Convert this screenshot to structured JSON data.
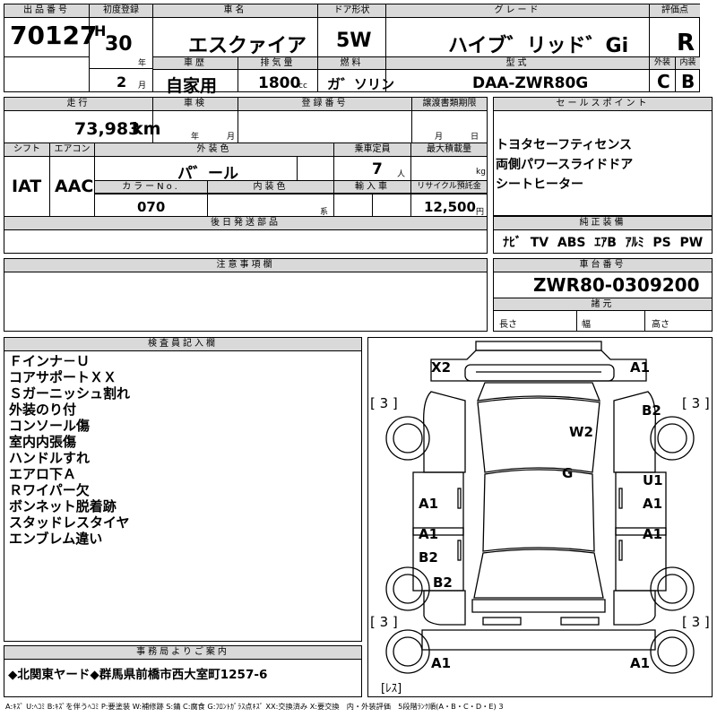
{
  "header": {
    "lot_label": "出品番号",
    "lot_no": "70127",
    "first_reg_label": "初度登録",
    "era": "H",
    "year": "30",
    "year_unit": "年",
    "month": "2",
    "month_unit": "月",
    "car_name_label": "車名",
    "car_name": "エスクァイア",
    "door_label": "ドア形状",
    "door": "5W",
    "grade_label": "グレード",
    "grade": "ハイブ゛リッド゛Gi",
    "score_label": "評価点",
    "score": "R",
    "history_label": "車歴",
    "history": "自家用",
    "disp_label": "排気量",
    "disp": "1800",
    "disp_unit": "cc",
    "fuel_label": "燃料",
    "fuel": "ガ゛ソリン",
    "model_label": "型式",
    "model": "DAA-ZWR80G",
    "ext_label": "外装",
    "ext": "C",
    "int_label": "内装",
    "int": "B"
  },
  "row2": {
    "mileage_label": "走行",
    "mileage": "73,983",
    "mileage_unit": "km",
    "inspection_label": "車検",
    "insp_year_unit": "年",
    "insp_month_unit": "月",
    "regno_label": "登録番号",
    "transfer_label": "譲渡書類期限",
    "trans_month_unit": "月",
    "trans_day_unit": "日",
    "shift_label": "シフト",
    "shift": "IAT",
    "ac_label": "エアコン",
    "ac": "AAC",
    "color_label": "外装色",
    "color": "パ゛ール",
    "seats_label": "乗車定員",
    "seats": "7",
    "seats_unit": "人",
    "load_label": "最大積載量",
    "load_unit": "kg",
    "colorno_label": "カラーNo.",
    "colorno": "070",
    "intcolor_label": "内装色",
    "intcolor_unit": "系",
    "import_label": "輸入車",
    "recycle_label": "リサイクル預託金",
    "recycle": "12,500",
    "recycle_unit": "円",
    "later_label": "後日発送部品"
  },
  "sales": {
    "label": "セールスポイント",
    "items": [
      "トヨタセーフティセンス",
      "両側パワースライドドア",
      "シートヒーター"
    ]
  },
  "equipment": {
    "label": "純正装備",
    "items": [
      "ﾅﾋﾞ",
      "TV",
      "ABS",
      "ｴｱB",
      "ｱﾙﾐ",
      "PS",
      "PW"
    ]
  },
  "notes": {
    "label": "注意事項欄"
  },
  "chassis": {
    "label": "車台番号",
    "value": "ZWR80-0309200",
    "dims_label": "諸元",
    "length_label": "長さ",
    "width_label": "幅",
    "height_label": "高さ"
  },
  "inspector": {
    "label": "検査員記入欄",
    "items": [
      "Ｆインナ－Ｕ",
      "コアサポートＸＸ",
      "Ｓガーニッシュ割れ",
      "外装のり付",
      "コンソール傷",
      "室内内張傷",
      "ハンドルすれ",
      "エアロ下Ａ",
      "Ｒワイパー欠",
      "ボンネット脱着跡",
      "スタッドレスタイヤ",
      "エンブレム違い"
    ]
  },
  "diagram": {
    "marks": [
      "X2",
      "A1",
      "B2",
      "W2",
      "G",
      "U1",
      "A1",
      "A1",
      "A1",
      "A1",
      "B2",
      "B2",
      "A1",
      "A1"
    ],
    "tread": [
      "[ 3 ]",
      "[ 3 ]",
      "[ 3 ]",
      "[ 3 ]"
    ],
    "spare": "[ﾚｽ]"
  },
  "office": {
    "label": "事務局よりご案内",
    "value": "◆北関東ヤード◆群馬県前橋市西大室町1257-6"
  },
  "legend": "A:ｷｽﾞ U:ﾍｺﾐ B:ｷｽﾞを伴うﾍｺﾐ P:要塗装 W:補修跡 S:錆 C:腐食 G:ﾌﾛﾝﾄｶﾞﾗｽ点ｷｽﾞ XX:交換済み X:要交換　内・外装評価　5段階ﾗﾝｸ順(A・B・C・D・E) 3"
}
